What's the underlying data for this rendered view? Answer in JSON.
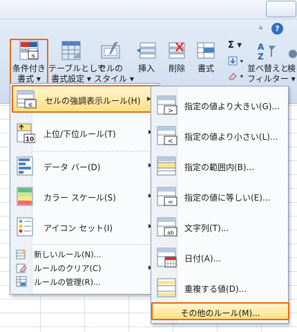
{
  "ribbon": {
    "buttons": {
      "conditional_format": [
        "条件付き",
        "書式 ▾"
      ],
      "format_as_table": [
        "テーブルとして",
        "書式設定 ▾"
      ],
      "cell_styles": [
        "セルの",
        "スタイル ▾"
      ],
      "insert": "挿入",
      "delete": "削除",
      "format": "書式",
      "sort_filter": [
        "並べ替えと",
        "フィルター ▾"
      ],
      "find_partial": "検"
    },
    "symbols": {
      "sum": "Σ ▾",
      "fill": "▾",
      "clear": "▾",
      "help": "?",
      "caret": "▵"
    }
  },
  "main_menu": {
    "items": [
      {
        "label": "セルの強調表示ルール(H)",
        "highlighted": true,
        "has_submenu": true
      },
      {
        "label": "上位/下位ルール(T)",
        "has_submenu": true
      },
      {
        "label": "データ バー(D)",
        "has_submenu": true
      },
      {
        "label": "カラー スケール(S)",
        "has_submenu": true
      },
      {
        "label": "アイコン セット(I)",
        "has_submenu": true
      }
    ],
    "small_items": [
      {
        "label": "新しいルール(N)..."
      },
      {
        "label": "ルールのクリア(C)",
        "has_submenu": true
      },
      {
        "label": "ルールの管理(R)..."
      }
    ],
    "arrow_glyph": "▶"
  },
  "sub_menu": {
    "items": [
      {
        "label": "指定の値より大きい(G)..."
      },
      {
        "label": "指定の値より小さい(L)..."
      },
      {
        "label": "指定の範囲内(B)..."
      },
      {
        "label": "指定の値に等しい(E)..."
      },
      {
        "label": "文字列(T)..."
      },
      {
        "label": "日付(A)..."
      },
      {
        "label": "重複する値(D)..."
      }
    ],
    "more_rules": "その他のルール(M)..."
  },
  "icon_glyphs": {
    "top10": "10",
    "greater": ">",
    "less": "<",
    "equal": "=",
    "text": "ab",
    "less_equal": "≤"
  },
  "colors": {
    "highlight_border": "#e56b13",
    "highlight_fill": "#ffdf83",
    "ribbon_bg": "#dbe6f4"
  }
}
